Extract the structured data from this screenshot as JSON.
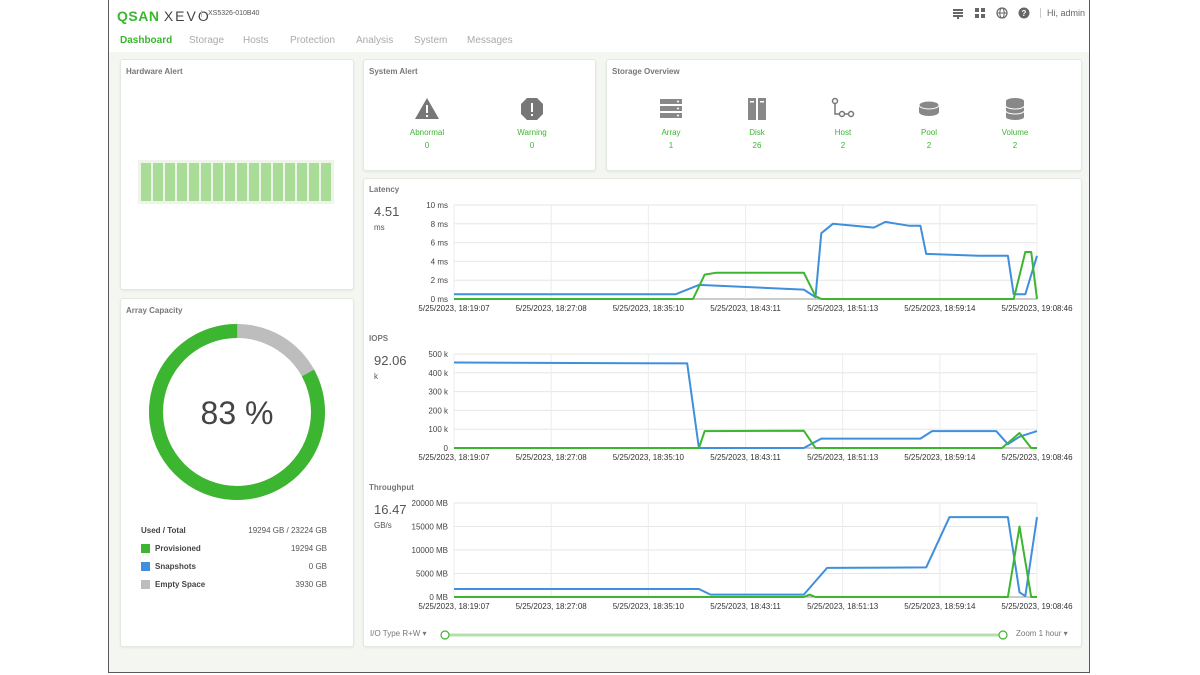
{
  "header": {
    "logo_brand": "QSAN",
    "logo_product": "XEVO",
    "model": "XS5326-010B40",
    "greeting": "Hi, admin",
    "icons": [
      "network-icon",
      "grid-icon",
      "globe-icon",
      "help-icon"
    ]
  },
  "nav": {
    "tabs": [
      {
        "label": "Dashboard",
        "active": true
      },
      {
        "label": "Storage"
      },
      {
        "label": "Hosts"
      },
      {
        "label": "Protection"
      },
      {
        "label": "Analysis"
      },
      {
        "label": "System"
      },
      {
        "label": "Messages"
      }
    ]
  },
  "hardware_alert": {
    "title": "Hardware Alert",
    "slots": 16
  },
  "system_alert": {
    "title": "System Alert",
    "items": [
      {
        "label": "Abnormal",
        "count": "0",
        "icon": "warning-triangle-icon"
      },
      {
        "label": "Warning",
        "count": "0",
        "icon": "warning-octagon-icon"
      }
    ]
  },
  "storage_overview": {
    "title": "Storage Overview",
    "items": [
      {
        "label": "Array",
        "count": "1",
        "icon": "array-icon"
      },
      {
        "label": "Disk",
        "count": "26",
        "icon": "disk-icon"
      },
      {
        "label": "Host",
        "count": "2",
        "icon": "host-icon"
      },
      {
        "label": "Pool",
        "count": "2",
        "icon": "pool-icon"
      },
      {
        "label": "Volume",
        "count": "2",
        "icon": "volume-icon"
      }
    ]
  },
  "array_capacity": {
    "title": "Array Capacity",
    "percent_text": "83 %",
    "used_fraction": 0.83,
    "used_total_label": "Used / Total",
    "used_total_value": "19294 GB / 23224 GB",
    "legend": [
      {
        "name": "Provisioned",
        "value": "19294 GB",
        "color": "#3cb530"
      },
      {
        "name": "Snapshots",
        "value": "0 GB",
        "color": "#3f8fdc"
      },
      {
        "name": "Empty Space",
        "value": "3930 GB",
        "color": "#bdbdbd"
      }
    ]
  },
  "colors": {
    "accent": "#3cb530",
    "blue": "#3f8fdc",
    "gray": "#bdbdbd"
  },
  "charts_meta": {
    "latency": {
      "title": "Latency",
      "value": "4.51",
      "unit": "ms"
    },
    "iops": {
      "title": "IOPS",
      "value": "92.06",
      "unit": "k"
    },
    "throughput": {
      "title": "Throughput",
      "value": "16.47",
      "unit": "GB/s"
    }
  },
  "controls": {
    "io_type": "I/O Type R+W",
    "zoom": "Zoom 1 hour"
  },
  "chart_data": [
    {
      "type": "line",
      "title": "Latency",
      "x_labels": [
        "5/25/2023, 18:19:07",
        "5/25/2023, 18:27:08",
        "5/25/2023, 18:35:10",
        "5/25/2023, 18:43:11",
        "5/25/2023, 18:51:13",
        "5/25/2023, 18:59:14",
        "5/25/2023, 19:08:46"
      ],
      "y_ticks": [
        "0 ms",
        "2 ms",
        "4 ms",
        "6 ms",
        "8 ms",
        "10 ms"
      ],
      "ylim": [
        0,
        10
      ],
      "series": [
        {
          "color": "#3f8fdc",
          "points": [
            [
              0,
              0.5
            ],
            [
              0.38,
              0.5
            ],
            [
              0.42,
              1.5
            ],
            [
              0.6,
              1.0
            ],
            [
              0.62,
              0.2
            ],
            [
              0.63,
              7.0
            ],
            [
              0.65,
              8.0
            ],
            [
              0.72,
              7.6
            ],
            [
              0.74,
              8.2
            ],
            [
              0.78,
              7.8
            ],
            [
              0.8,
              7.8
            ],
            [
              0.81,
              4.8
            ],
            [
              0.9,
              4.6
            ],
            [
              0.95,
              4.6
            ],
            [
              0.96,
              0.5
            ],
            [
              0.98,
              0.5
            ],
            [
              1.0,
              4.6
            ]
          ]
        },
        {
          "color": "#3cb530",
          "points": [
            [
              0,
              0
            ],
            [
              0.41,
              0
            ],
            [
              0.43,
              2.6
            ],
            [
              0.45,
              2.8
            ],
            [
              0.6,
              2.8
            ],
            [
              0.62,
              0.3
            ],
            [
              0.63,
              0
            ],
            [
              0.96,
              0
            ],
            [
              0.98,
              5.0
            ],
            [
              0.99,
              5.0
            ],
            [
              1.0,
              0
            ]
          ]
        }
      ]
    },
    {
      "type": "line",
      "title": "IOPS",
      "x_labels": [
        "5/25/2023, 18:19:07",
        "5/25/2023, 18:27:08",
        "5/25/2023, 18:35:10",
        "5/25/2023, 18:43:11",
        "5/25/2023, 18:51:13",
        "5/25/2023, 18:59:14",
        "5/25/2023, 19:08:46"
      ],
      "y_ticks": [
        "0",
        "100 k",
        "200 k",
        "300 k",
        "400 k",
        "500 k"
      ],
      "ylim": [
        0,
        500
      ],
      "series": [
        {
          "color": "#3f8fdc",
          "points": [
            [
              0,
              455
            ],
            [
              0.4,
              450
            ],
            [
              0.42,
              0
            ],
            [
              0.6,
              0
            ],
            [
              0.63,
              50
            ],
            [
              0.8,
              50
            ],
            [
              0.82,
              90
            ],
            [
              0.93,
              90
            ],
            [
              0.95,
              20
            ],
            [
              0.97,
              60
            ],
            [
              1.0,
              90
            ]
          ]
        },
        {
          "color": "#3cb530",
          "points": [
            [
              0,
              0
            ],
            [
              0.42,
              0
            ],
            [
              0.43,
              90
            ],
            [
              0.6,
              92
            ],
            [
              0.62,
              0
            ],
            [
              0.94,
              0
            ],
            [
              0.97,
              80
            ],
            [
              0.99,
              0
            ],
            [
              1.0,
              0
            ]
          ]
        }
      ]
    },
    {
      "type": "line",
      "title": "Throughput",
      "x_labels": [
        "5/25/2023, 18:19:07",
        "5/25/2023, 18:27:08",
        "5/25/2023, 18:35:10",
        "5/25/2023, 18:43:11",
        "5/25/2023, 18:51:13",
        "5/25/2023, 18:59:14",
        "5/25/2023, 19:08:46"
      ],
      "y_ticks": [
        "0 MB",
        "5000 MB",
        "10000 MB",
        "15000 MB",
        "20000 MB"
      ],
      "ylim": [
        0,
        20000
      ],
      "series": [
        {
          "color": "#3f8fdc",
          "points": [
            [
              0,
              1700
            ],
            [
              0.42,
              1700
            ],
            [
              0.44,
              500
            ],
            [
              0.6,
              500
            ],
            [
              0.64,
              6200
            ],
            [
              0.81,
              6300
            ],
            [
              0.85,
              17000
            ],
            [
              0.95,
              17000
            ],
            [
              0.97,
              1000
            ],
            [
              0.98,
              200
            ],
            [
              1.0,
              17000
            ]
          ]
        },
        {
          "color": "#3cb530",
          "points": [
            [
              0,
              0
            ],
            [
              0.6,
              0
            ],
            [
              0.61,
              500
            ],
            [
              0.62,
              0
            ],
            [
              0.95,
              0
            ],
            [
              0.97,
              15000
            ],
            [
              0.99,
              0
            ],
            [
              1.0,
              0
            ]
          ]
        }
      ]
    }
  ]
}
